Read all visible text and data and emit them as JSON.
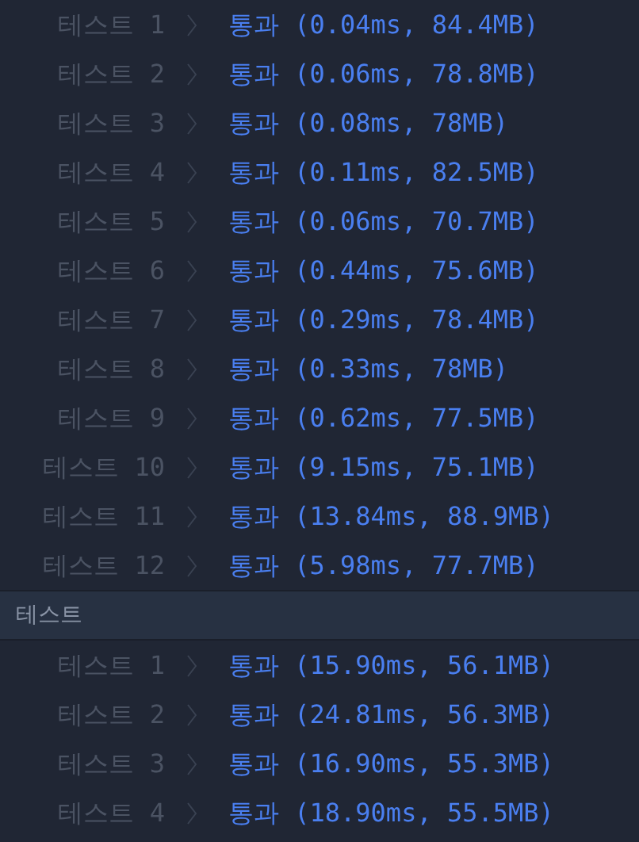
{
  "sections": [
    {
      "tests": [
        {
          "label": "테스트 1",
          "result": "통과 (0.04ms, 84.4MB)"
        },
        {
          "label": "테스트 2",
          "result": "통과 (0.06ms, 78.8MB)"
        },
        {
          "label": "테스트 3",
          "result": "통과 (0.08ms, 78MB)"
        },
        {
          "label": "테스트 4",
          "result": "통과 (0.11ms, 82.5MB)"
        },
        {
          "label": "테스트 5",
          "result": "통과 (0.06ms, 70.7MB)"
        },
        {
          "label": "테스트 6",
          "result": "통과 (0.44ms, 75.6MB)"
        },
        {
          "label": "테스트 7",
          "result": "통과 (0.29ms, 78.4MB)"
        },
        {
          "label": "테스트 8",
          "result": "통과 (0.33ms, 78MB)"
        },
        {
          "label": "테스트 9",
          "result": "통과 (0.62ms, 77.5MB)"
        },
        {
          "label": "테스트 10",
          "result": "통과 (9.15ms, 75.1MB)"
        },
        {
          "label": "테스트 11",
          "result": "통과 (13.84ms, 88.9MB)"
        },
        {
          "label": "테스트 12",
          "result": "통과 (5.98ms, 77.7MB)"
        }
      ]
    },
    {
      "title": "테스트",
      "tests": [
        {
          "label": "테스트 1",
          "result": "통과 (15.90ms, 56.1MB)"
        },
        {
          "label": "테스트 2",
          "result": "통과 (24.81ms, 56.3MB)"
        },
        {
          "label": "테스트 3",
          "result": "통과 (16.90ms, 55.3MB)"
        },
        {
          "label": "테스트 4",
          "result": "통과 (18.90ms, 55.5MB)"
        }
      ]
    }
  ]
}
